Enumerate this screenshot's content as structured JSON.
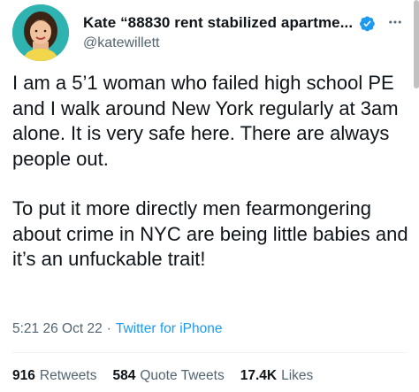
{
  "author": {
    "display_name": "Kate “88830 rent stabilized apartme...",
    "handle": "@katewillett",
    "verified": true,
    "avatar_icon": "profile-photo",
    "verified_icon": "verified-badge-icon",
    "more_icon": "more-options-icon"
  },
  "tweet": {
    "paragraphs": [
      "I am a 5’1 woman who failed high school PE and I walk around New York regularly at 3am alone. It is very safe here. There are always people out.",
      "To put it more directly men fearmongering about crime in NYC are being little babies and it’s an unfuckable trait!"
    ],
    "time": "5:21",
    "date": "26 Oct 22",
    "separator": "·",
    "source": "Twitter for iPhone"
  },
  "stats": {
    "retweets": {
      "count": "916",
      "label": "Retweets"
    },
    "quote_tweets": {
      "count": "584",
      "label": "Quote Tweets"
    },
    "likes": {
      "count": "17.4K",
      "label": "Likes"
    }
  },
  "colors": {
    "text": "#0f1419",
    "secondary": "#536471",
    "accent": "#1d9bf0",
    "avatar_bg": "#2fb3b1"
  }
}
